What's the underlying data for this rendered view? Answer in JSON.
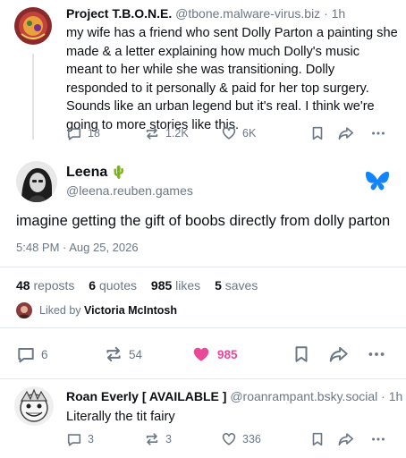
{
  "post1": {
    "display_name": "Project T.B.O.N.E.",
    "handle": "@tbone.malware-virus.biz",
    "time": "· 1h",
    "text": "my wife has a friend who sent Dolly Parton a painting she made & a letter explaining how much Dolly's music meant to her while she was transitioning. Dolly responded to it personally & paid for her top surgery. Sounds like an urban legend but it's real. I think we're going to more stories like this.",
    "reply_count": "18",
    "repost_count": "1.2K",
    "like_count": "6K",
    "icons": [
      "reply-icon",
      "repost-icon",
      "like-icon",
      "bookmark-icon",
      "share-icon",
      "more-icon"
    ]
  },
  "main_post": {
    "display_name": "Leena",
    "emoji": "🌵",
    "handle": "@leena.reuben.games",
    "text": "imagine getting the gift of boobs directly from dolly parton",
    "timestamp": "5:48 PM · Aug 25, 2026",
    "stats": {
      "reposts_num": "48",
      "reposts_label": "reposts",
      "quotes_num": "6",
      "quotes_label": "quotes",
      "likes_num": "985",
      "likes_label": "likes",
      "saves_num": "5",
      "saves_label": "saves"
    },
    "liked_by_prefix": "Liked by",
    "liked_by_name": "Victoria McIntosh",
    "reply_count": "6",
    "repost_count": "54",
    "like_count": "985",
    "like_color": "#ec4899",
    "brand_icon": "bluesky-butterfly-icon",
    "brand_color": "#1185fe"
  },
  "reply": {
    "display_name": "Roan Everly [ AVAILABLE ]",
    "handle": "@roanrampant.bsky.social",
    "time": "· 1h",
    "text": "Literally the tit fairy",
    "reply_count": "3",
    "repost_count": "3",
    "like_count": "336"
  }
}
